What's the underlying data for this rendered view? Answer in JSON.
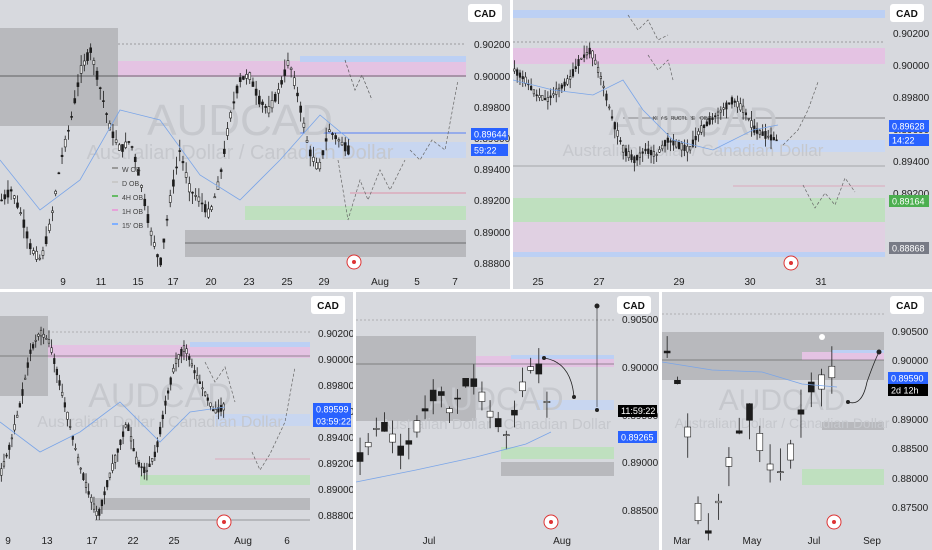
{
  "panels": [
    {
      "id": "p1",
      "currency": "CAD",
      "watermark_symbol": "AUDCAD",
      "watermark_name": "Australian Dollar / Canadian Dollar",
      "y_ticks": [
        "0.90200",
        "0.90000",
        "0.89800",
        "0.89600",
        "0.89400",
        "0.89200",
        "0.89000",
        "0.88800"
      ],
      "ylim": [
        0.8875,
        0.905
      ],
      "x_ticks": [
        "9",
        "11",
        "15",
        "17",
        "20",
        "23",
        "25",
        "29",
        "Aug",
        "5",
        "7"
      ],
      "price_tag": "0.89644",
      "time_tag": "59:22",
      "legend": [
        {
          "label": "W OB",
          "color": "#9a9a9a"
        },
        {
          "label": "D OB",
          "color": "#c9c9c9"
        },
        {
          "label": "4H OB",
          "color": "#66bb66"
        },
        {
          "label": "1H OB",
          "color": "#e6a3d9"
        },
        {
          "label": "15' OB",
          "color": "#7fb0ff"
        }
      ]
    },
    {
      "id": "p2",
      "currency": "CAD",
      "watermark_symbol": "AUDCAD",
      "watermark_name": "Australian Dollar / Canadian Dollar",
      "y_ticks": [
        "0.90200",
        "0.90000",
        "0.89800",
        "0.89600",
        "0.89400",
        "0.89200"
      ],
      "ylim": [
        0.8875,
        0.905
      ],
      "x_ticks": [
        "25",
        "27",
        "29",
        "30",
        "31"
      ],
      "price_tag": "0.89628",
      "time_tag": "14:22",
      "green_tag": "0.89164",
      "gray_tag": "0.88868",
      "annotation": "KEY STRUCTURE POINT"
    },
    {
      "id": "p3",
      "currency": "CAD",
      "watermark_symbol": "AUDCAD",
      "watermark_name": "Australian Dollar / Canadian Dollar",
      "y_ticks": [
        "0.90200",
        "0.90000",
        "0.89800",
        "0.89600",
        "0.89400",
        "0.89200",
        "0.89000",
        "0.88800"
      ],
      "ylim": [
        0.8875,
        0.903
      ],
      "x_ticks": [
        "9",
        "13",
        "17",
        "22",
        "25",
        "Aug",
        "6"
      ],
      "price_tag": "0.89599",
      "time_tag": "03:59:22"
    },
    {
      "id": "p4",
      "currency": "CAD",
      "watermark_symbol": "AUDCAD",
      "watermark_name": "Australian Dollar / Canadian Dollar",
      "y_ticks": [
        "0.90500",
        "0.90000",
        "0.89500",
        "0.89000",
        "0.88500"
      ],
      "ylim": [
        0.882,
        0.907
      ],
      "x_ticks": [
        "Jul",
        "Aug"
      ],
      "price_tag": "0.89265",
      "time_tag": "11:59:22"
    },
    {
      "id": "p5",
      "currency": "CAD",
      "watermark_symbol": "AUDCAD",
      "watermark_name": "Australian Dollar / Canadian Dollar",
      "y_ticks": [
        "0.90500",
        "0.90000",
        "0.89500",
        "0.89000",
        "0.88500",
        "0.88000",
        "0.87500"
      ],
      "ylim": [
        0.871,
        0.908
      ],
      "x_ticks": [
        "Mar",
        "May",
        "Jul",
        "Sep"
      ],
      "price_tag": "0.89590",
      "time_tag": "2d 12h"
    }
  ],
  "colors": {
    "price_tag": "#2962ff",
    "green_tag": "#4caf50",
    "gray_tag": "#787b86",
    "time_tag_dark": "#000000",
    "candle": "#1c1c1c",
    "zone_gray": "#b8b9bd",
    "zone_pink": "#e4c3e3",
    "zone_blue": "#bcd0f4",
    "zone_green": "#bfe0bf"
  }
}
